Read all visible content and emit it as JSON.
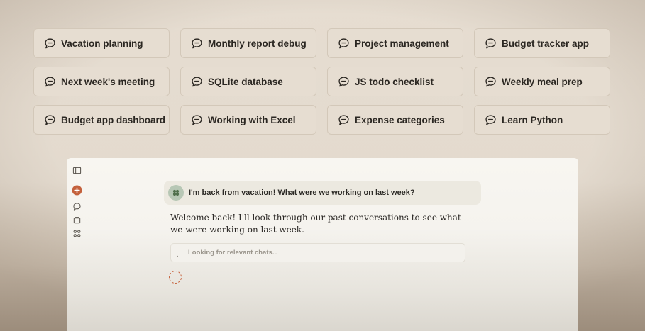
{
  "suggestions": [
    {
      "label": "Vacation planning",
      "icon": "chat-bubble-icon"
    },
    {
      "label": "Monthly report debug",
      "icon": "chat-bubble-icon"
    },
    {
      "label": "Project management",
      "icon": "chat-bubble-icon"
    },
    {
      "label": "Budget tracker app",
      "icon": "chat-bubble-icon"
    },
    {
      "label": "Next week's meeting",
      "icon": "chat-bubble-icon"
    },
    {
      "label": "SQLite database",
      "icon": "chat-bubble-icon"
    },
    {
      "label": "JS todo checklist",
      "icon": "chat-bubble-icon"
    },
    {
      "label": "Weekly meal prep",
      "icon": "chat-bubble-icon"
    },
    {
      "label": "Budget app dashboard",
      "icon": "chat-bubble-icon"
    },
    {
      "label": "Working with Excel",
      "icon": "chat-bubble-icon"
    },
    {
      "label": "Expense categories",
      "icon": "chat-bubble-icon"
    },
    {
      "label": "Learn Python",
      "icon": "chat-bubble-icon"
    }
  ],
  "sidebar": {
    "icons": [
      "sidebar-toggle-icon",
      "new-chat-icon",
      "chats-icon",
      "projects-icon",
      "artifacts-icon"
    ],
    "accent": "#c4613c"
  },
  "chat": {
    "user_message": "I'm back from vacation! What were we working on last week?",
    "assistant_message": "Welcome back! I'll look through our past conversations to see what we were working on last week.",
    "tool_status": "Looking for relevant chats...",
    "tool_indicator": "."
  },
  "colors": {
    "background": "#e6ddd1",
    "chip_border": "#d3c8b9",
    "accent": "#c4613c",
    "avatar": "#b7c7b5"
  }
}
